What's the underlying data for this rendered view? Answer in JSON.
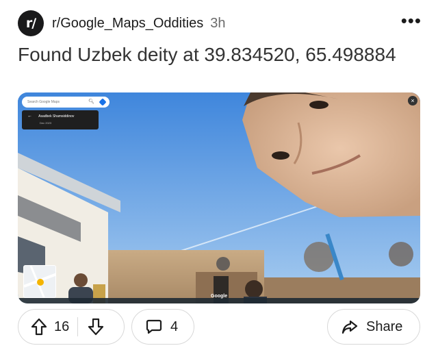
{
  "post": {
    "subreddit_icon_text": "r/",
    "subreddit": "r/Google_Maps_Oddities",
    "time_ago": "3h",
    "more_icon": "•••",
    "title": "Found Uzbek deity at 39.834520, 65.498884"
  },
  "media": {
    "search_placeholder": "Search Google Maps",
    "contributor_name": "Asadbek Shamsiddinov",
    "capture_date": "Dec 2023",
    "close_icon": "×",
    "watermark": "Google"
  },
  "actions": {
    "upvote_count": "16",
    "comment_count": "4",
    "share_label": "Share"
  },
  "icons": {
    "upvote": "upvote-arrow-icon",
    "downvote": "downvote-arrow-icon",
    "comment": "comment-bubble-icon",
    "share": "share-arrow-icon"
  },
  "colors": {
    "sky": "#5ea0e6",
    "text": "#1c1c1c",
    "muted": "#6a6a6a",
    "border": "#d8d8d8"
  }
}
